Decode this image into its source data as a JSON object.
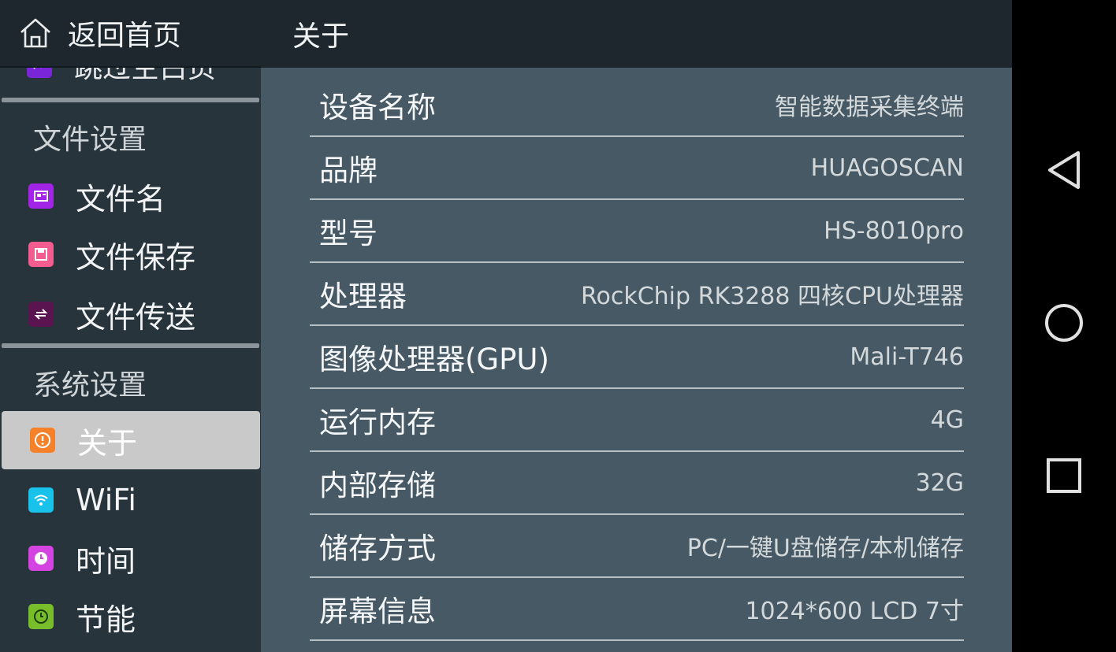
{
  "sidebar": {
    "back_label": "返回首页",
    "partial_item_label": "跳过空白页",
    "sections": [
      {
        "title": "文件设置",
        "items": [
          {
            "label": "文件名",
            "icon": "file-name-icon",
            "color": "#a224e6"
          },
          {
            "label": "文件保存",
            "icon": "file-save-icon",
            "color": "#f25c8f"
          },
          {
            "label": "文件传送",
            "icon": "file-transfer-icon",
            "color": "#5a1450"
          }
        ]
      },
      {
        "title": "系统设置",
        "items": [
          {
            "label": "关于",
            "icon": "about-icon",
            "color": "#f5822a",
            "active": true
          },
          {
            "label": "WiFi",
            "icon": "wifi-icon",
            "color": "#19c2ea"
          },
          {
            "label": "时间",
            "icon": "clock-icon",
            "color": "#d444e0"
          },
          {
            "label": "节能",
            "icon": "power-save-icon",
            "color": "#78be2a"
          }
        ]
      }
    ]
  },
  "main": {
    "title": "关于",
    "rows": [
      {
        "key": "设备名称",
        "value": "智能数据采集终端"
      },
      {
        "key": "品牌",
        "value": "HUAGOSCAN"
      },
      {
        "key": "型号",
        "value": "HS-8010pro"
      },
      {
        "key": "处理器",
        "value": "RockChip RK3288 四核CPU处理器"
      },
      {
        "key": "图像处理器(GPU)",
        "value": "Mali-T746"
      },
      {
        "key": "运行内存",
        "value": "4G"
      },
      {
        "key": "内部存储",
        "value": "32G"
      },
      {
        "key": "储存方式",
        "value": "PC/一键U盘储存/本机储存"
      },
      {
        "key": "屏幕信息",
        "value": "1024*600  LCD 7寸"
      }
    ]
  },
  "navbar": {
    "buttons": [
      "back-nav-icon",
      "home-nav-icon",
      "recents-nav-icon"
    ]
  }
}
